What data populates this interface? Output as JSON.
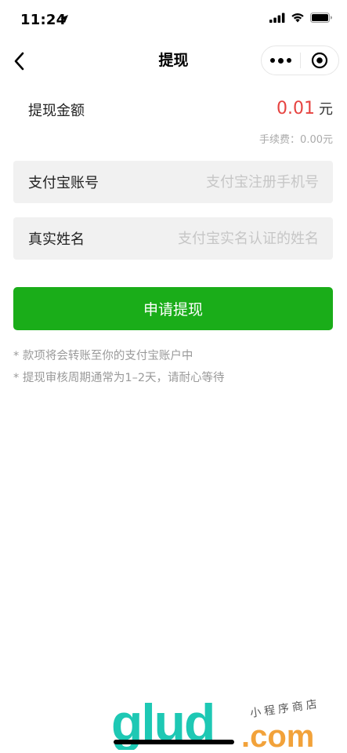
{
  "status_bar": {
    "time": "11:24"
  },
  "nav": {
    "title": "提现"
  },
  "amount": {
    "label": "提现金额",
    "value": "0.01",
    "unit": "元",
    "fee_text": "手续费：0.00元"
  },
  "form": {
    "account_label": "支付宝账号",
    "account_placeholder": "支付宝注册手机号",
    "account_value": "",
    "name_label": "真实姓名",
    "name_placeholder": "支付宝实名认证的姓名",
    "name_value": ""
  },
  "submit": {
    "label": "申请提现"
  },
  "notes": [
    "* 款项将会转账至你的支付宝账户中",
    "* 提现审核周期通常为1–2天，请耐心等待"
  ],
  "watermark": {
    "brand": "glud",
    "tagline": "小程序商店",
    "suffix": ".com"
  },
  "colors": {
    "accent_green": "#1aad19",
    "amount_red": "#e64340",
    "field_bg": "#f1f1f1",
    "note_gray": "#9a9a9a"
  },
  "icons": {
    "back": "chevron-left-icon",
    "more": "more-dots-icon",
    "close": "capsule-close-icon",
    "signal": "signal-icon",
    "wifi": "wifi-icon",
    "battery": "battery-icon",
    "location": "location-arrow-icon"
  }
}
